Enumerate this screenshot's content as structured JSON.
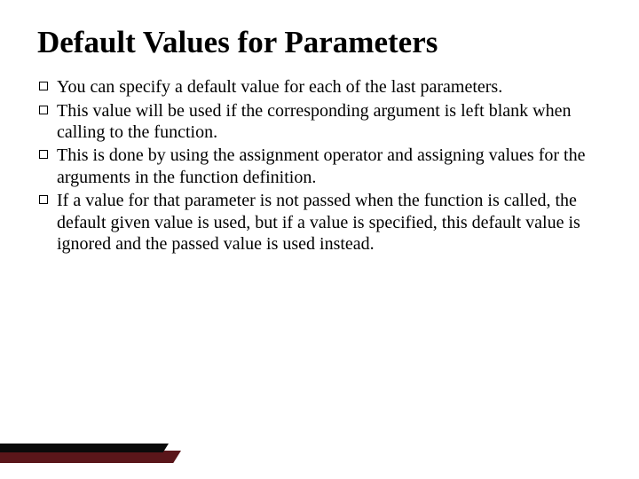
{
  "slide": {
    "title": "Default Values for Parameters",
    "bullets": [
      "You can specify a default value for each of the last parameters.",
      "This value will be used if the corresponding argument is left blank when calling to the function.",
      "This is done by using the assignment operator and assigning values for the arguments in the function definition.",
      " If a value for that parameter is not passed when the function is called, the default given value is used, but if a value is specified, this default value is ignored and the passed value is used instead."
    ]
  },
  "theme": {
    "accent_dark": "#0a0a0a",
    "accent_maroon": "#5a161a"
  }
}
